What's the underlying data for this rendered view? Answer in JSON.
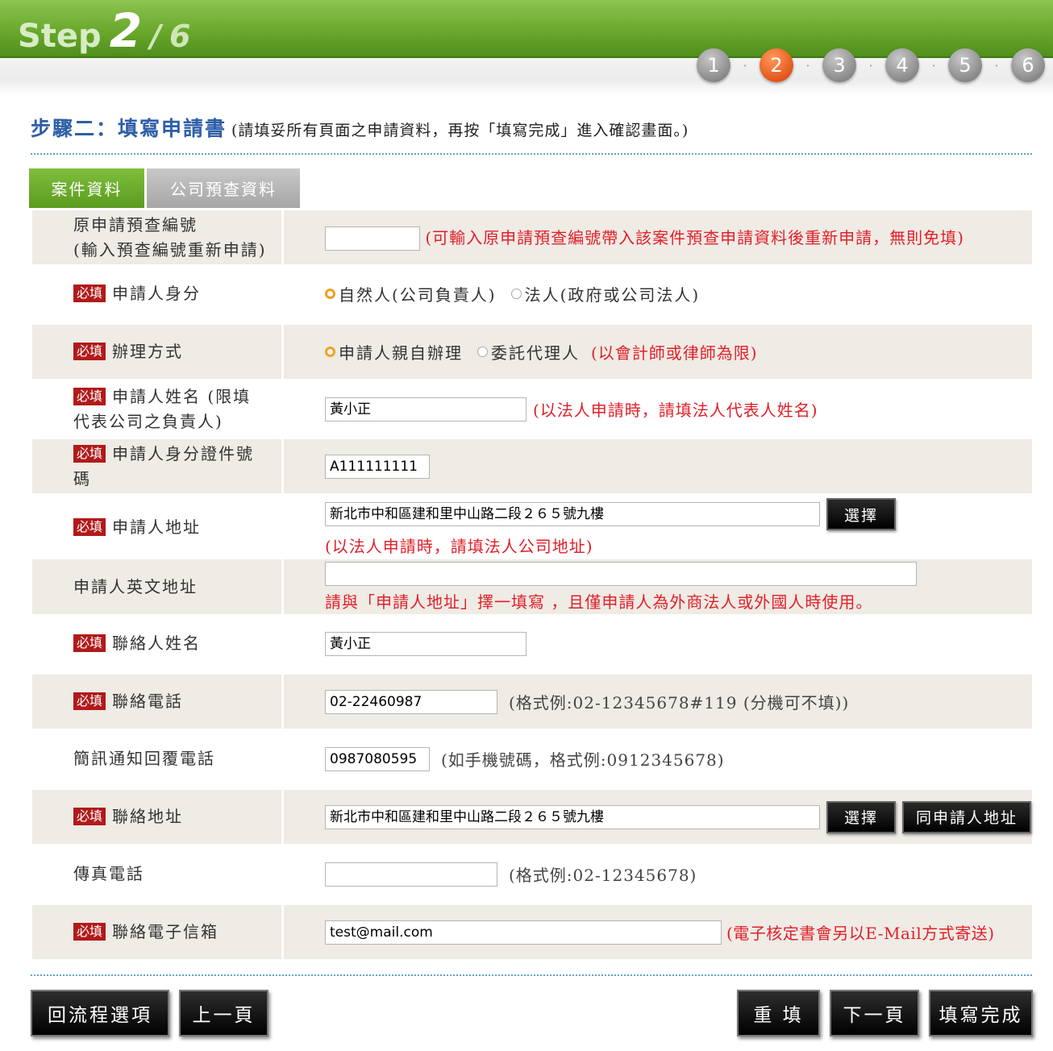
{
  "header": {
    "step_word": "Step",
    "step_current": "2",
    "step_separator": "/",
    "step_total": "6",
    "dots": [
      "1",
      "2",
      "3",
      "4",
      "5",
      "6"
    ],
    "dot_separator": "·",
    "active_step": 2,
    "accent_color": "#6aa92d"
  },
  "title": {
    "main": "步驟二：填寫申請書",
    "sub": "(請填妥所有頁面之申請資料，再按「填寫完成」進入確認畫面。)"
  },
  "tabs": [
    {
      "label": "案件資料",
      "active": true
    },
    {
      "label": "公司預查資料",
      "active": false
    }
  ],
  "required_badge": "必填",
  "form": {
    "original_no": {
      "label1": "原申請預查編號",
      "label2": "(輸入預查編號重新申請)",
      "value": "",
      "hint": "(可輸入原申請預查編號帶入該案件預查申請資料後重新申請，無則免填)"
    },
    "applicant_identity": {
      "label": "申請人身分",
      "options": [
        "自然人(公司負責人)",
        "法人(政府或公司法人)"
      ],
      "selected": 0
    },
    "handling_method": {
      "label": "辦理方式",
      "options": [
        "申請人親自辦理",
        "委託代理人"
      ],
      "selected": 0,
      "hint": "(以會計師或律師為限)"
    },
    "applicant_name": {
      "label1": "申請人姓名 (限填",
      "label2": "代表公司之負責人)",
      "value": "黃小正",
      "hint": "(以法人申請時，請填法人代表人姓名)"
    },
    "applicant_id": {
      "label1": "申請人身分證件號",
      "label2": "碼",
      "value": "A111111111"
    },
    "applicant_address": {
      "label": "申請人地址",
      "value": "新北市中和區建和里中山路二段２６５號九樓",
      "button": "選擇",
      "hint": "(以法人申請時，請填法人公司地址)"
    },
    "applicant_en_address": {
      "label": "申請人英文地址",
      "value": "",
      "hint": "請與「申請人地址」擇一填寫 ，且僅申請人為外商法人或外國人時使用。"
    },
    "contact_name": {
      "label": "聯絡人姓名",
      "value": "黃小正"
    },
    "contact_phone": {
      "label": "聯絡電話",
      "value": "02-22460987",
      "hint": "(格式例:02-12345678#119 (分機可不填))"
    },
    "sms_phone": {
      "label": "簡訊通知回覆電話",
      "value": "0987080595",
      "hint": "(如手機號碼，格式例:0912345678)"
    },
    "contact_address": {
      "label": "聯絡地址",
      "value": "新北市中和區建和里中山路二段２６５號九樓",
      "button": "選擇",
      "button2": "同申請人地址"
    },
    "fax": {
      "label": "傳真電話",
      "value": "",
      "hint": "(格式例:02-12345678)"
    },
    "email": {
      "label": "聯絡電子信箱",
      "value": "test@mail.com",
      "hint": "(電子核定書會另以E-Mail方式寄送)"
    }
  },
  "buttons": {
    "back_to_flow": "回流程選項",
    "prev": "上一頁",
    "reset": "重 填",
    "next": "下一頁",
    "done": "填寫完成"
  }
}
